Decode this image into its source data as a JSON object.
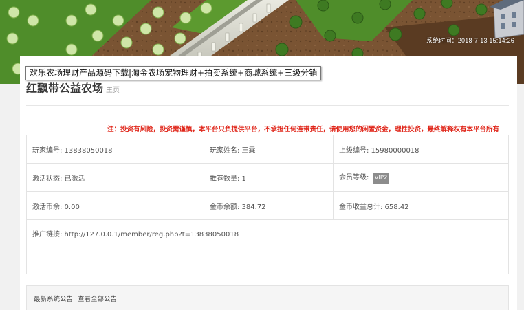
{
  "header": {
    "system_time": "系统时间：2018-7-13 15:14:26"
  },
  "tooltip": {
    "text": "欢乐农场理财产品源码下载|淘金农场宠物理财+拍卖系统+商城系统+三级分销"
  },
  "page": {
    "title": "红飘带公益农场",
    "breadcrumb": "主页"
  },
  "warning": "注：投资有风险，投资需谨慎，本平台只负提供平台，不承担任何连带责任，请使用您的闲置资金，理性投资，最终解释权有本平台所有",
  "info": {
    "player_id": "玩家编号: 13838050018",
    "player_name": "玩家姓名: 王霖",
    "parent_id": "上级编号: 15980000018",
    "activation_status": "激活状态: 已激活",
    "referral_count": "推荐数量: 1",
    "member_level_label": "会员等级:",
    "member_level_badge": "VIP2",
    "activation_coins": "激活币余: 0.00",
    "gold_balance": "金币余额: 384.72",
    "gold_earnings_total": "金币收益总计: 658.42",
    "promo_link": "推广链接: http://127.0.0.1/member/reg.php?t=13838050018"
  },
  "notice": {
    "label": "最新系统公告",
    "view_all": "查看全部公告"
  },
  "colors": {
    "warning": "#e0271b",
    "vip_badge": "#8c8c8c"
  }
}
